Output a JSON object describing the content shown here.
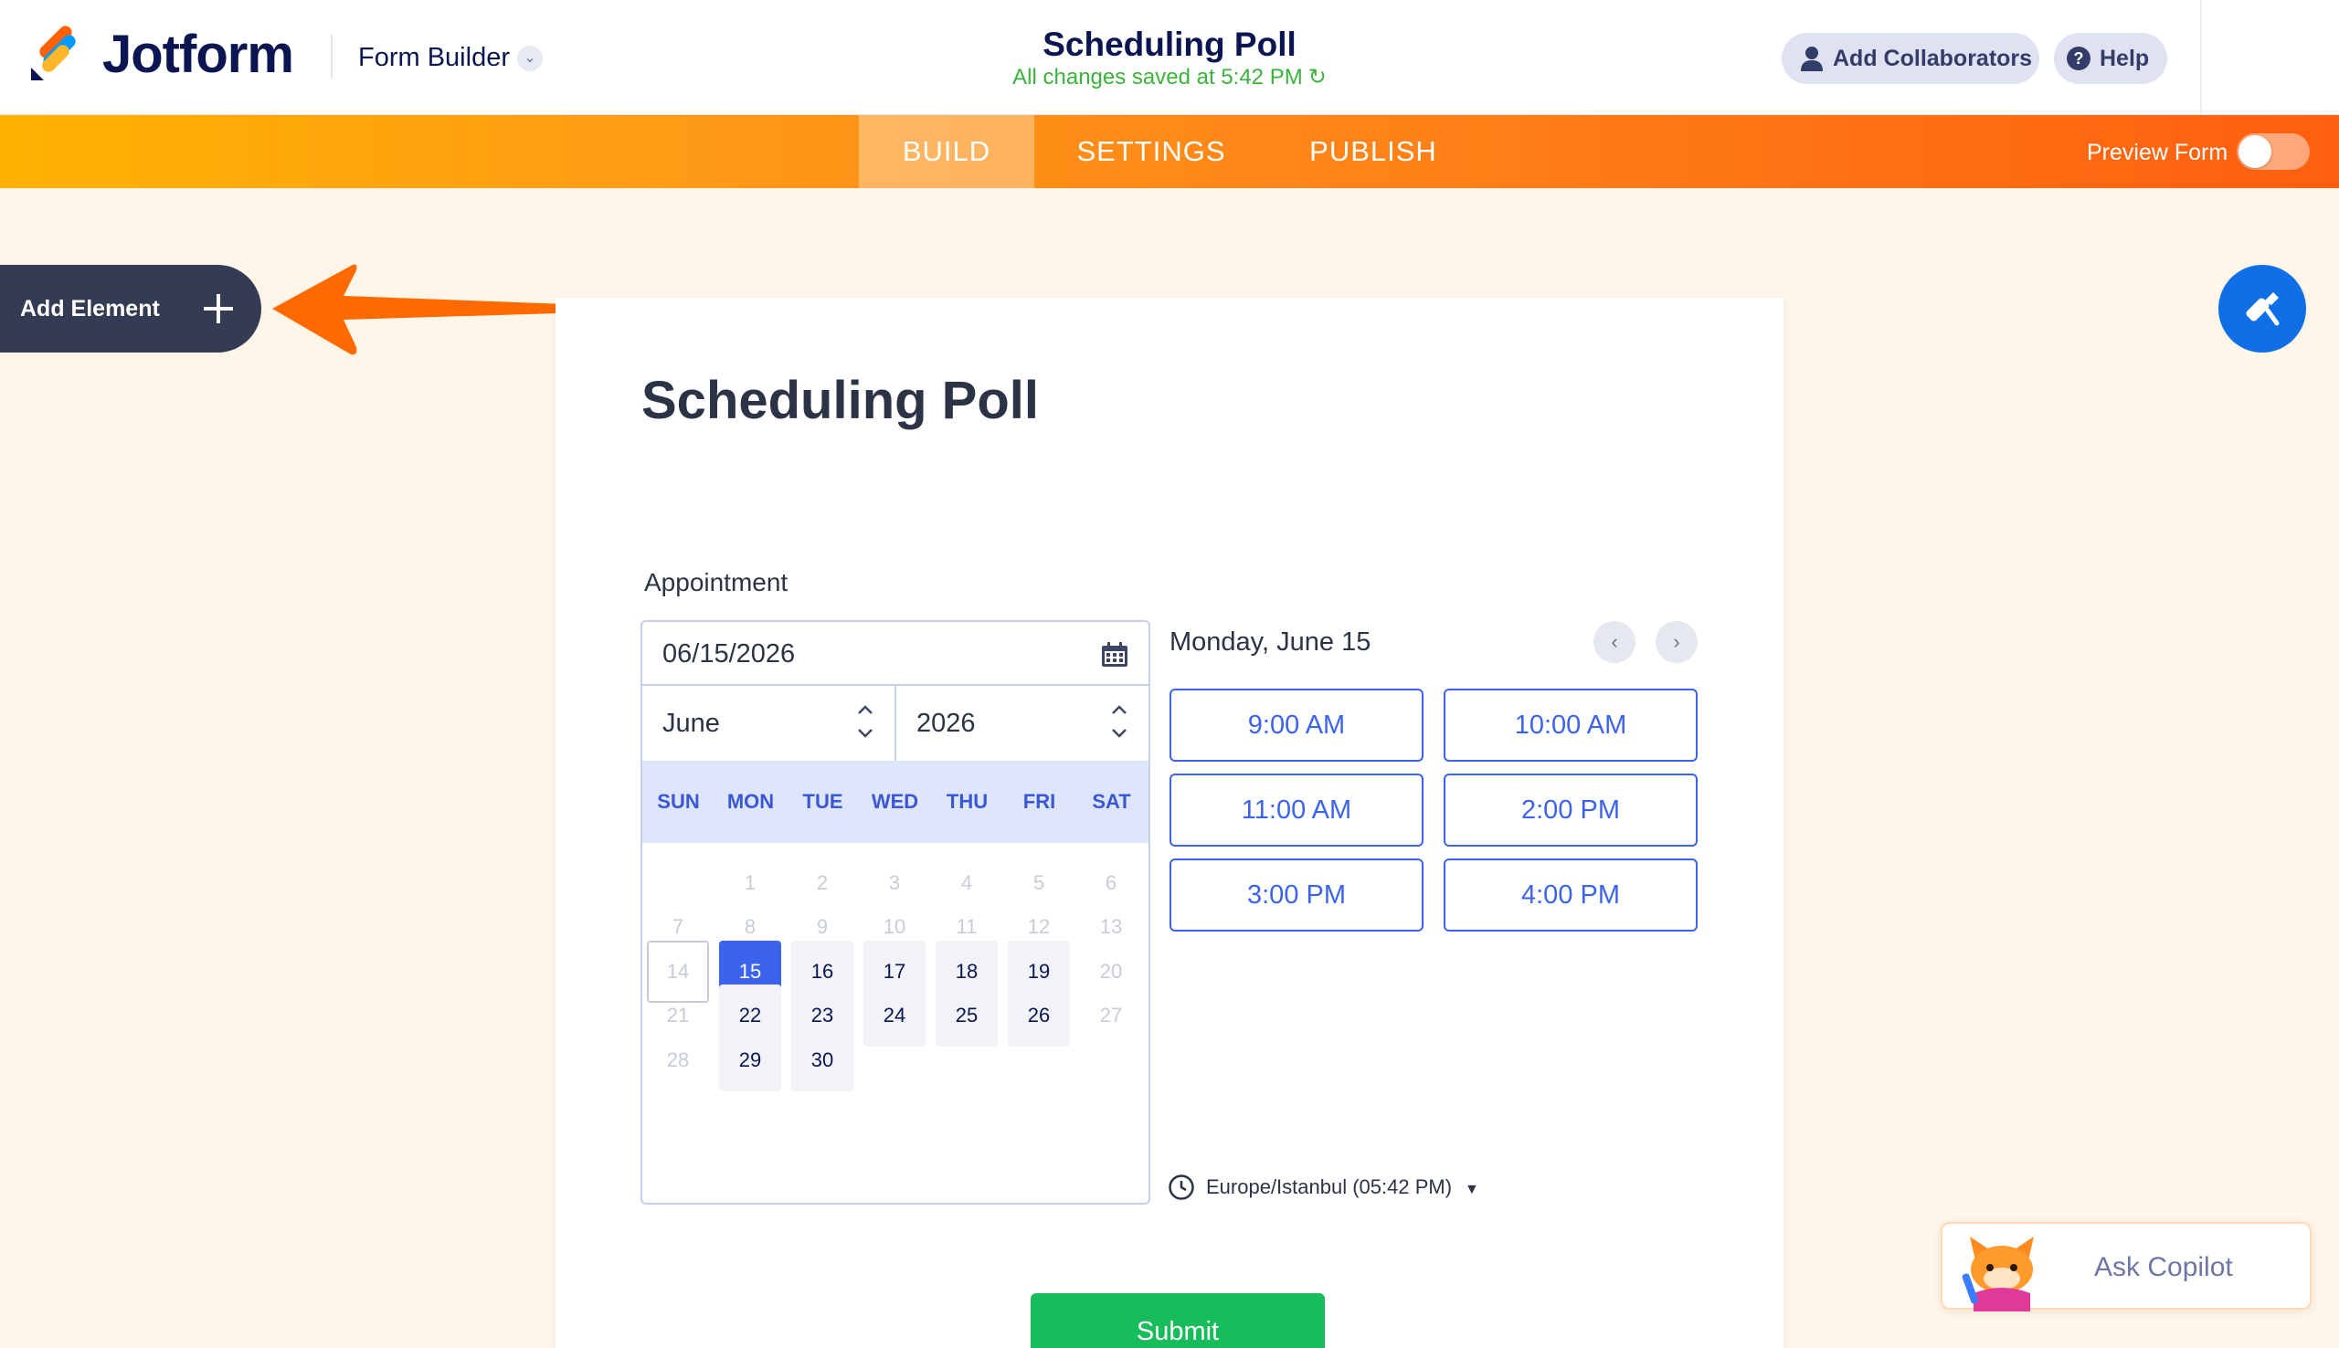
{
  "header": {
    "brand": "Jotform",
    "builder_label": "Form Builder",
    "doc_title": "Scheduling Poll",
    "save_status": "All changes saved at 5:42 PM",
    "collab_label": "Add Collaborators",
    "help_label": "Help"
  },
  "nav": {
    "tabs": [
      "BUILD",
      "SETTINGS",
      "PUBLISH"
    ],
    "active_tab": "BUILD",
    "preview_label": "Preview Form",
    "preview_enabled": false
  },
  "sidebar": {
    "add_element_label": "Add Element"
  },
  "form": {
    "title": "Scheduling Poll",
    "field_label": "Appointment",
    "date_value": "06/15/2026",
    "month_value": "June",
    "year_value": "2026",
    "weekdays": [
      "SUN",
      "MON",
      "TUE",
      "WED",
      "THU",
      "FRI",
      "SAT"
    ],
    "days": [
      "1",
      "2",
      "3",
      "4",
      "5",
      "6",
      "7",
      "8",
      "9",
      "10",
      "11",
      "12",
      "13",
      "14",
      "15",
      "16",
      "17",
      "18",
      "19",
      "20",
      "21",
      "22",
      "23",
      "24",
      "25",
      "26",
      "27",
      "28",
      "29",
      "30"
    ],
    "first_weekday_index": 1,
    "today_day": 14,
    "selected_day": 15,
    "available_days": [
      15,
      16,
      17,
      18,
      19,
      22,
      23,
      24,
      25,
      26,
      29,
      30
    ],
    "slot_date_label": "Monday, June 15",
    "time_slots": [
      "9:00 AM",
      "10:00 AM",
      "11:00 AM",
      "2:00 PM",
      "3:00 PM",
      "4:00 PM"
    ],
    "timezone": "Europe/Istanbul (05:42 PM)",
    "submit_label": "Submit"
  },
  "copilot": {
    "label": "Ask Copilot"
  },
  "colors": {
    "brand_navy": "#0a1551",
    "accent_blue": "#3b63ee",
    "submit_green": "#18bd5b",
    "save_green": "#3bb33b",
    "nav_orange_start": "#ffb200",
    "nav_orange_end": "#ff5f0f"
  },
  "icons": [
    "jotform-logo-icon",
    "chevron-down-icon",
    "refresh-icon",
    "user-icon",
    "question-icon",
    "plus-icon",
    "arrow-left-icon",
    "paint-roller-icon",
    "calendar-icon",
    "chevron-up-down-icon",
    "chevron-left-icon",
    "chevron-right-icon",
    "clock-icon",
    "caret-down-icon",
    "copilot-cat-icon"
  ]
}
